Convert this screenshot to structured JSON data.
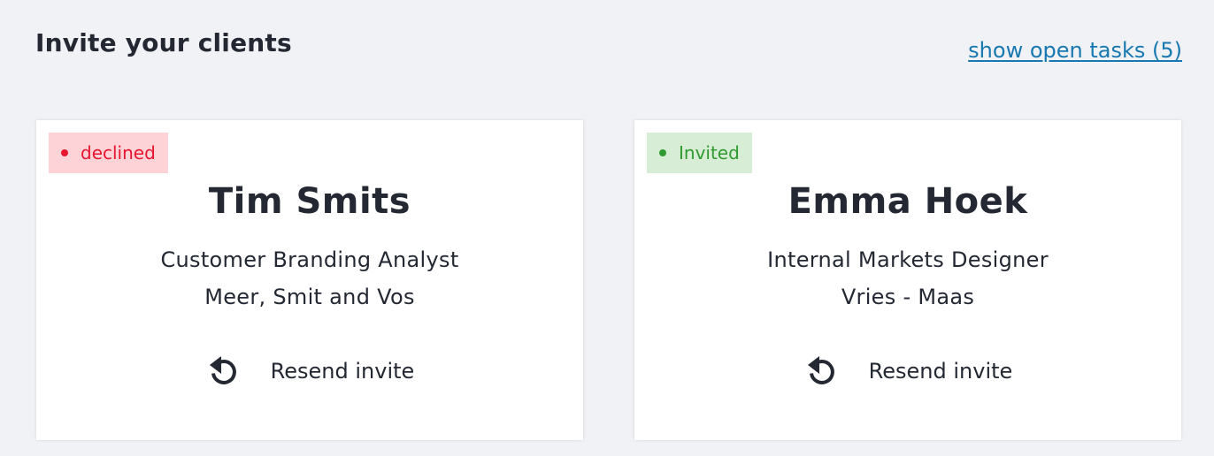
{
  "header": {
    "title": "Invite your clients",
    "open_tasks_link": "show open tasks (5)"
  },
  "clients": [
    {
      "status": "declined",
      "name": "Tim Smits",
      "role": "Customer Branding Analyst",
      "company": "Meer, Smit and Vos",
      "action_label": "Resend invite",
      "action_icon": "resend-icon"
    },
    {
      "status": "Invited",
      "name": "Emma Hoek",
      "role": "Internal Markets Designer",
      "company": "Vries - Maas",
      "action_label": "Resend invite",
      "action_icon": "resend-icon"
    }
  ],
  "colors": {
    "background": "#f1f2f6",
    "link": "#1878b0",
    "declined_text": "#e8152e",
    "declined_bg": "#fdd3d8",
    "invited_text": "#2f9a2f",
    "invited_bg": "#d7edd5",
    "text": "#232833"
  }
}
